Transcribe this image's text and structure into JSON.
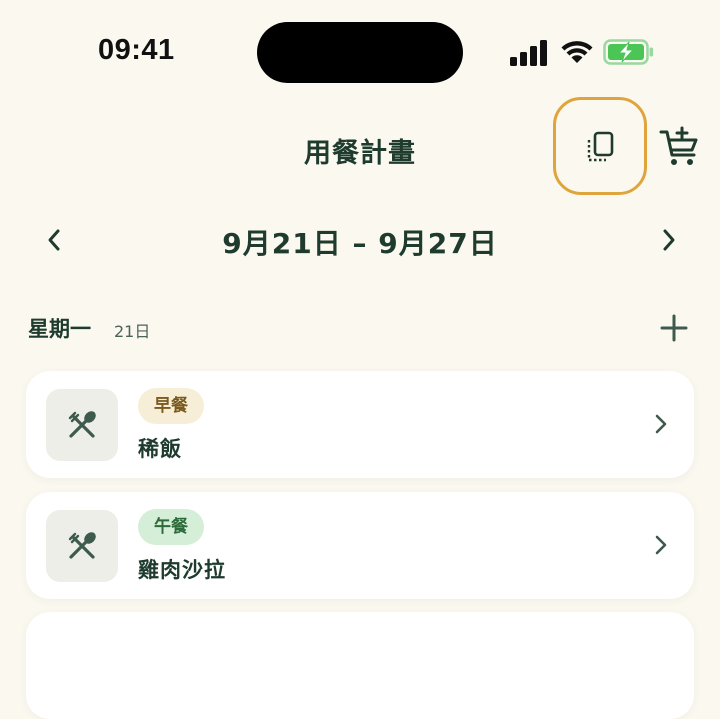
{
  "status_bar": {
    "time": "09:41",
    "icons": [
      "cellular-signal-icon",
      "wifi-icon",
      "battery-charging-icon"
    ]
  },
  "header": {
    "title": "用餐計畫",
    "actions": [
      "copy-icon",
      "add-to-cart-icon"
    ]
  },
  "week": {
    "label": "9月21日 – 9月27日",
    "prev_icon": "chevron-left-icon",
    "next_icon": "chevron-right-icon"
  },
  "day": {
    "name": "星期一",
    "date": "21日",
    "add_icon": "plus-icon"
  },
  "meals": [
    {
      "type": "早餐",
      "name": "稀飯",
      "icon": "fork-spoon-icon"
    },
    {
      "type": "午餐",
      "name": "雞肉沙拉",
      "icon": "fork-spoon-icon"
    }
  ],
  "colors": {
    "background": "#FAF8EF",
    "primary_text": "#1E3B2E",
    "highlight_ring": "#E0A43D",
    "breakfast_badge": "#F6EED7",
    "lunch_badge": "#D5EED7",
    "battery_green": "#4CC557"
  }
}
